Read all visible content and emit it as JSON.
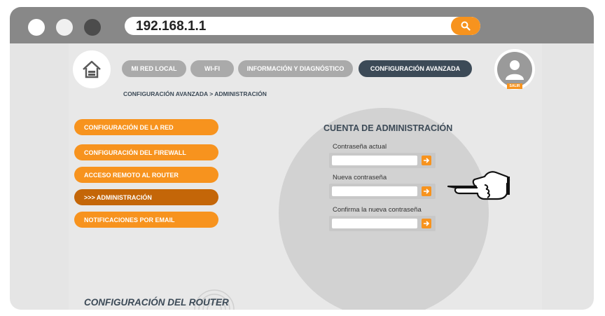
{
  "browser": {
    "url": "192.168.1.1",
    "search_icon": "search-icon"
  },
  "nav": {
    "home_icon": "home-icon",
    "tabs": [
      {
        "label": "MI RED LOCAL"
      },
      {
        "label": "WI-FI"
      },
      {
        "label": "INFORMACIÓN Y DIAGNÓSTICO"
      },
      {
        "label": "CONFIGURACIÓN AVANZADA"
      }
    ],
    "breadcrumb": "CONFIGURACIÓN AVANZADA > ADMINISTRACIÓN",
    "logout_label": "SALIR"
  },
  "sidebar": {
    "items": [
      {
        "label": "CONFIGURACIÓN DE LA RED"
      },
      {
        "label": "CONFIGURACIÓN DEL FIREWALL"
      },
      {
        "label": "ACCESO REMOTO AL ROUTER"
      },
      {
        "label": ">>> ADMINISTRACIÓN"
      },
      {
        "label": "NOTIFICACIONES POR EMAIL"
      }
    ]
  },
  "form": {
    "title": "CUENTA DE ADMINISTRACIÓN",
    "fields": [
      {
        "label": "Contraseña actual",
        "value": ""
      },
      {
        "label": "Nueva contraseña",
        "value": ""
      },
      {
        "label": "Confirma la nueva contraseña",
        "value": ""
      }
    ]
  },
  "footer": {
    "title": "CONFIGURACIÓN DEL ROUTER"
  },
  "colors": {
    "accent": "#f7931e",
    "accent_dark": "#c46608",
    "navy": "#3c4a57",
    "tab_gray": "#aaaaaa"
  }
}
